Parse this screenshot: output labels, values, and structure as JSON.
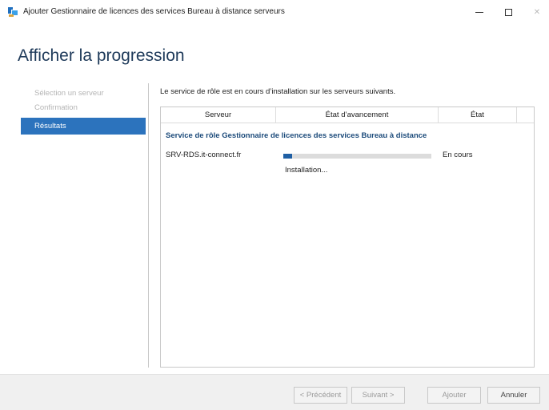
{
  "window": {
    "title": "Ajouter Gestionnaire de licences des services Bureau à distance serveurs",
    "controls": {
      "minimize_icon": "minimize-icon",
      "maximize_icon": "maximize-icon",
      "close_icon": "close-icon",
      "close_glyph": "✕"
    }
  },
  "page_title": "Afficher la progression",
  "nav": {
    "items": [
      {
        "label": "Sélection un serveur",
        "state": "disabled"
      },
      {
        "label": "Confirmation",
        "state": "disabled"
      },
      {
        "label": "Résultats",
        "state": "selected"
      }
    ]
  },
  "description": "Le service de rôle est en cours d’installation sur les serveurs suivants.",
  "grid": {
    "columns": [
      "Serveur",
      "État d’avancement",
      "État"
    ],
    "group_title": "Service de rôle Gestionnaire de licences des services Bureau à distance",
    "rows": [
      {
        "server": "SRV-RDS.it-connect.fr",
        "progress": 0.06,
        "status": "En cours",
        "substep": "Installation..."
      }
    ]
  },
  "buttons": {
    "previous": "< Précédent",
    "next": "Suivant >",
    "add": "Ajouter",
    "cancel": "Annuler"
  },
  "colors": {
    "accent": "#2c73bd",
    "progress": "#1f5fa4",
    "heading": "#1e3a5a"
  }
}
